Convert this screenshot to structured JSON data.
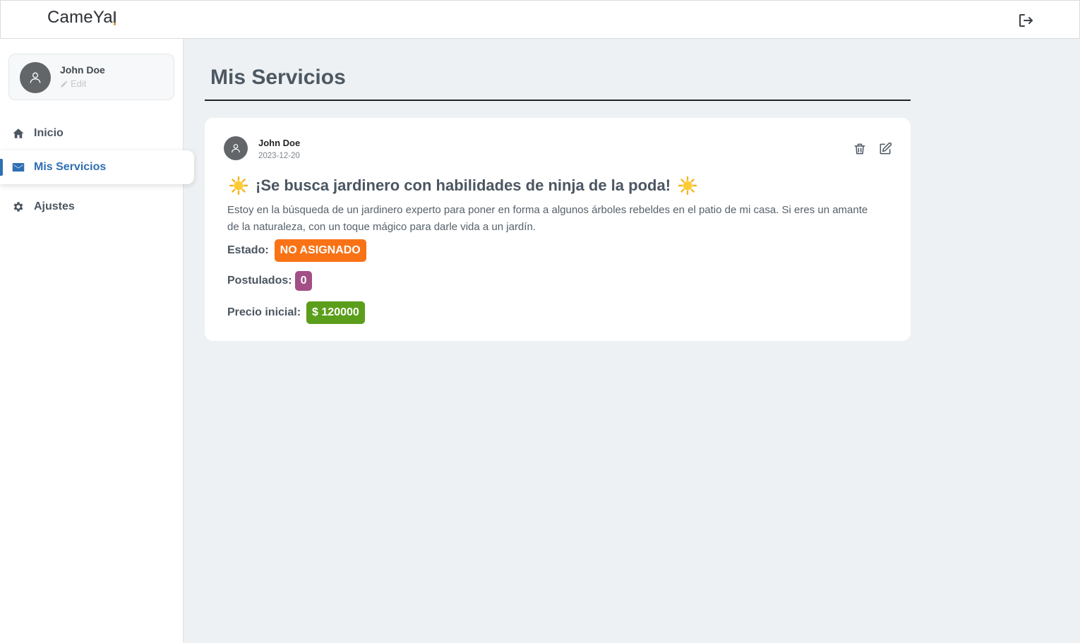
{
  "app": {
    "brand": "CameYa",
    "logout_icon": "logout-icon"
  },
  "sidebar": {
    "profile": {
      "name": "John Doe",
      "edit_label": "Edit",
      "avatar_icon": "user-icon",
      "edit_icon": "pencil-icon"
    },
    "items": [
      {
        "label": "Inicio",
        "icon": "home-icon",
        "active": false
      },
      {
        "label": "Mis Servicios",
        "icon": "envelope-icon",
        "active": true
      },
      {
        "label": "Ajustes",
        "icon": "gear-icon",
        "active": false
      }
    ]
  },
  "main": {
    "title": "Mis Servicios",
    "services": [
      {
        "author": "John Doe",
        "date": "2023-12-20",
        "title": "¡Se busca jardinero con habilidades de ninja de la poda!",
        "title_decoration": "sun-icon",
        "description": "Estoy en la búsqueda de un jardinero experto para poner en forma a algunos árboles rebeldes en el patio de mi casa. Si eres un amante de la naturaleza, con un toque mágico para darle vida a un jardín.",
        "status_label": "Estado:",
        "status_value": "NO ASIGNADO",
        "applicants_label": "Postulados:",
        "applicants_value": "0",
        "price_label": "Precio inicial:",
        "price_value": "$ 120000",
        "actions": [
          "trash-icon",
          "edit-icon"
        ]
      }
    ]
  },
  "colors": {
    "accent": "#2f6fb3",
    "status_badge": "#f97316",
    "applicants_badge": "#a24f86",
    "price_badge": "#5b9e1b",
    "background": "#eef1f3"
  }
}
